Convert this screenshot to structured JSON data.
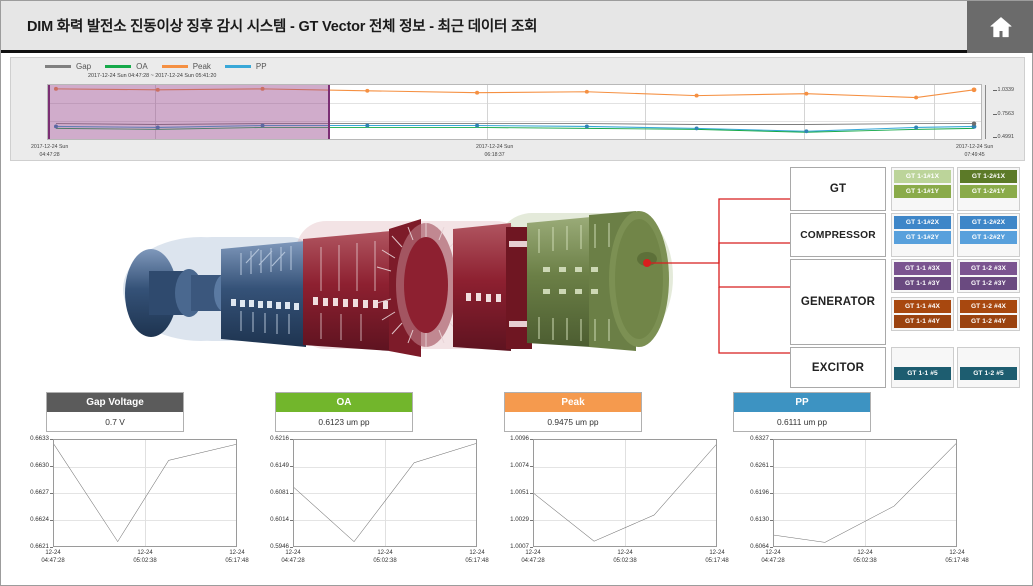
{
  "header": {
    "title": "DIM  화력 발전소 진동이상 징후 감시 시스템 - GT Vector 전체 정보 - 최근 데이터 조회",
    "home_icon": "home-icon"
  },
  "overview": {
    "legend": [
      {
        "label": "Gap",
        "color": "#808080"
      },
      {
        "label": "OA",
        "color": "#16a94a"
      },
      {
        "label": "Peak",
        "color": "#f59042"
      },
      {
        "label": "PP",
        "color": "#39a8d8"
      }
    ],
    "selection_label": "2017-12-24 Sun 04:47:28 ~ 2017-12-24 Sun 05:41:20",
    "selection_color": "#96468c",
    "x_ticks": [
      "2017-12-24 Sun\n04:47:28",
      "2017-12-24 Sun\n06:18:37",
      "2017-12-24 Sun\n07:49:45"
    ],
    "y_ticks": [
      "1.0339",
      "0.7563",
      "0.4991"
    ]
  },
  "turbine": {
    "alt": "gas-turbine-cutaway",
    "sections": [
      {
        "name": "compressor",
        "color": "#3d5a80"
      },
      {
        "name": "turbine",
        "color": "#8d2030"
      },
      {
        "name": "exhaust",
        "color": "#6b7f46"
      }
    ],
    "marker_color": "#d81e1e"
  },
  "tree": {
    "groups": [
      {
        "name": "GT",
        "columns": [
          {
            "sensors": [
              {
                "label": "GT 1-1#1X",
                "color": "#bcd49a"
              },
              {
                "label": "GT 1-1#1Y",
                "color": "#8aab4a"
              }
            ]
          },
          {
            "sensors": [
              {
                "label": "GT 1-2#1X",
                "color": "#5c7a28"
              },
              {
                "label": "GT 1-2#1Y",
                "color": "#8aab4a"
              }
            ]
          }
        ]
      },
      {
        "name": "COMPRESSOR",
        "columns": [
          {
            "sensors": [
              {
                "label": "GT 1-1#2X",
                "color": "#3e86c8"
              },
              {
                "label": "GT 1-1#2Y",
                "color": "#58a0dc"
              }
            ]
          },
          {
            "sensors": [
              {
                "label": "GT 1-2#2X",
                "color": "#3e86c8"
              },
              {
                "label": "GT 1-2#2Y",
                "color": "#58a0dc"
              }
            ]
          }
        ]
      },
      {
        "name": "GENERATOR",
        "columns": [
          {
            "sensors": [
              {
                "label": "GT 1-1 #3X",
                "color": "#7b5490"
              },
              {
                "label": "GT 1-1 #3Y",
                "color": "#6a4a80"
              }
            ]
          },
          {
            "sensors": [
              {
                "label": "GT 1-2 #3X",
                "color": "#7b5490"
              },
              {
                "label": "GT 1-2 #3Y",
                "color": "#6a4a80"
              }
            ]
          },
          {
            "sensors": [
              {
                "label": "GT 1-1 #4X",
                "color": "#a8480f"
              },
              {
                "label": "GT 1-1 #4Y",
                "color": "#9b4310"
              }
            ]
          },
          {
            "sensors": [
              {
                "label": "GT 1-2 #4X",
                "color": "#a8480f"
              },
              {
                "label": "GT 1-2 #4Y",
                "color": "#9b4310"
              }
            ]
          }
        ]
      },
      {
        "name": "EXCITOR",
        "columns": [
          {
            "sensors": [
              {
                "label": "GT 1-1 #5",
                "color": "#1d5d70"
              }
            ]
          },
          {
            "sensors": [
              {
                "label": "GT 1-2 #5",
                "color": "#1d5d70"
              }
            ]
          }
        ]
      }
    ]
  },
  "cards": [
    {
      "title": "Gap Voltage",
      "value": "0.7 V",
      "color": "#5b5b5b"
    },
    {
      "title": "OA",
      "value": "0.6123 um pp",
      "color": "#72b62c"
    },
    {
      "title": "Peak",
      "value": "0.9475 um pp",
      "color": "#f59a4e"
    },
    {
      "title": "PP",
      "value": "0.6111 um pp",
      "color": "#3d93c2"
    }
  ],
  "chart_data": [
    {
      "type": "line",
      "name": "Gap Voltage",
      "title": "Gap Voltage",
      "ylabel": "",
      "xlabel": "",
      "y_ticks": [
        "0.6621",
        "0.6624",
        "0.6627",
        "0.6630",
        "0.6633"
      ],
      "ylim": [
        0.6621,
        0.6633
      ],
      "x_ticks": [
        "12-24\n04:47:28",
        "12-24\n05:02:38",
        "12-24\n05:17:48"
      ],
      "x": [
        0,
        0.35,
        0.63,
        1.0
      ],
      "values": [
        0.66325,
        0.66215,
        0.66307,
        0.66325
      ],
      "grid": true
    },
    {
      "type": "line",
      "name": "OA",
      "title": "OA",
      "ylabel": "",
      "xlabel": "",
      "y_ticks": [
        "0.5946",
        "0.6014",
        "0.6081",
        "0.6149",
        "0.6216"
      ],
      "ylim": [
        0.5946,
        0.6216
      ],
      "x_ticks": [
        "12-24\n04:47:28",
        "12-24\n05:02:38",
        "12-24\n05:17:48"
      ],
      "x": [
        0,
        0.33,
        0.66,
        1.0
      ],
      "values": [
        0.6095,
        0.5957,
        0.6158,
        0.6207
      ],
      "grid": true
    },
    {
      "type": "line",
      "name": "Peak",
      "title": "Peak",
      "ylabel": "",
      "xlabel": "",
      "y_ticks": [
        "1.0007",
        "1.0029",
        "1.0051",
        "1.0074",
        "1.0096"
      ],
      "ylim": [
        1.0007,
        1.0096
      ],
      "x_ticks": [
        "12-24\n04:47:28",
        "12-24\n05:02:38",
        "12-24\n05:17:48"
      ],
      "x": [
        0,
        0.33,
        0.66,
        1.0
      ],
      "values": [
        1.0051,
        1.0011,
        1.0033,
        1.0092
      ],
      "grid": true
    },
    {
      "type": "line",
      "name": "PP",
      "title": "PP",
      "ylabel": "",
      "xlabel": "",
      "y_ticks": [
        "0.6064",
        "0.6130",
        "0.6196",
        "0.6261",
        "0.6327"
      ],
      "ylim": [
        0.6064,
        0.6327
      ],
      "x_ticks": [
        "12-24\n04:47:28",
        "12-24\n05:02:38",
        "12-24\n05:17:48"
      ],
      "x": [
        0,
        0.28,
        0.66,
        1.0
      ],
      "values": [
        0.6091,
        0.6073,
        0.6163,
        0.6318
      ],
      "grid": true
    }
  ]
}
